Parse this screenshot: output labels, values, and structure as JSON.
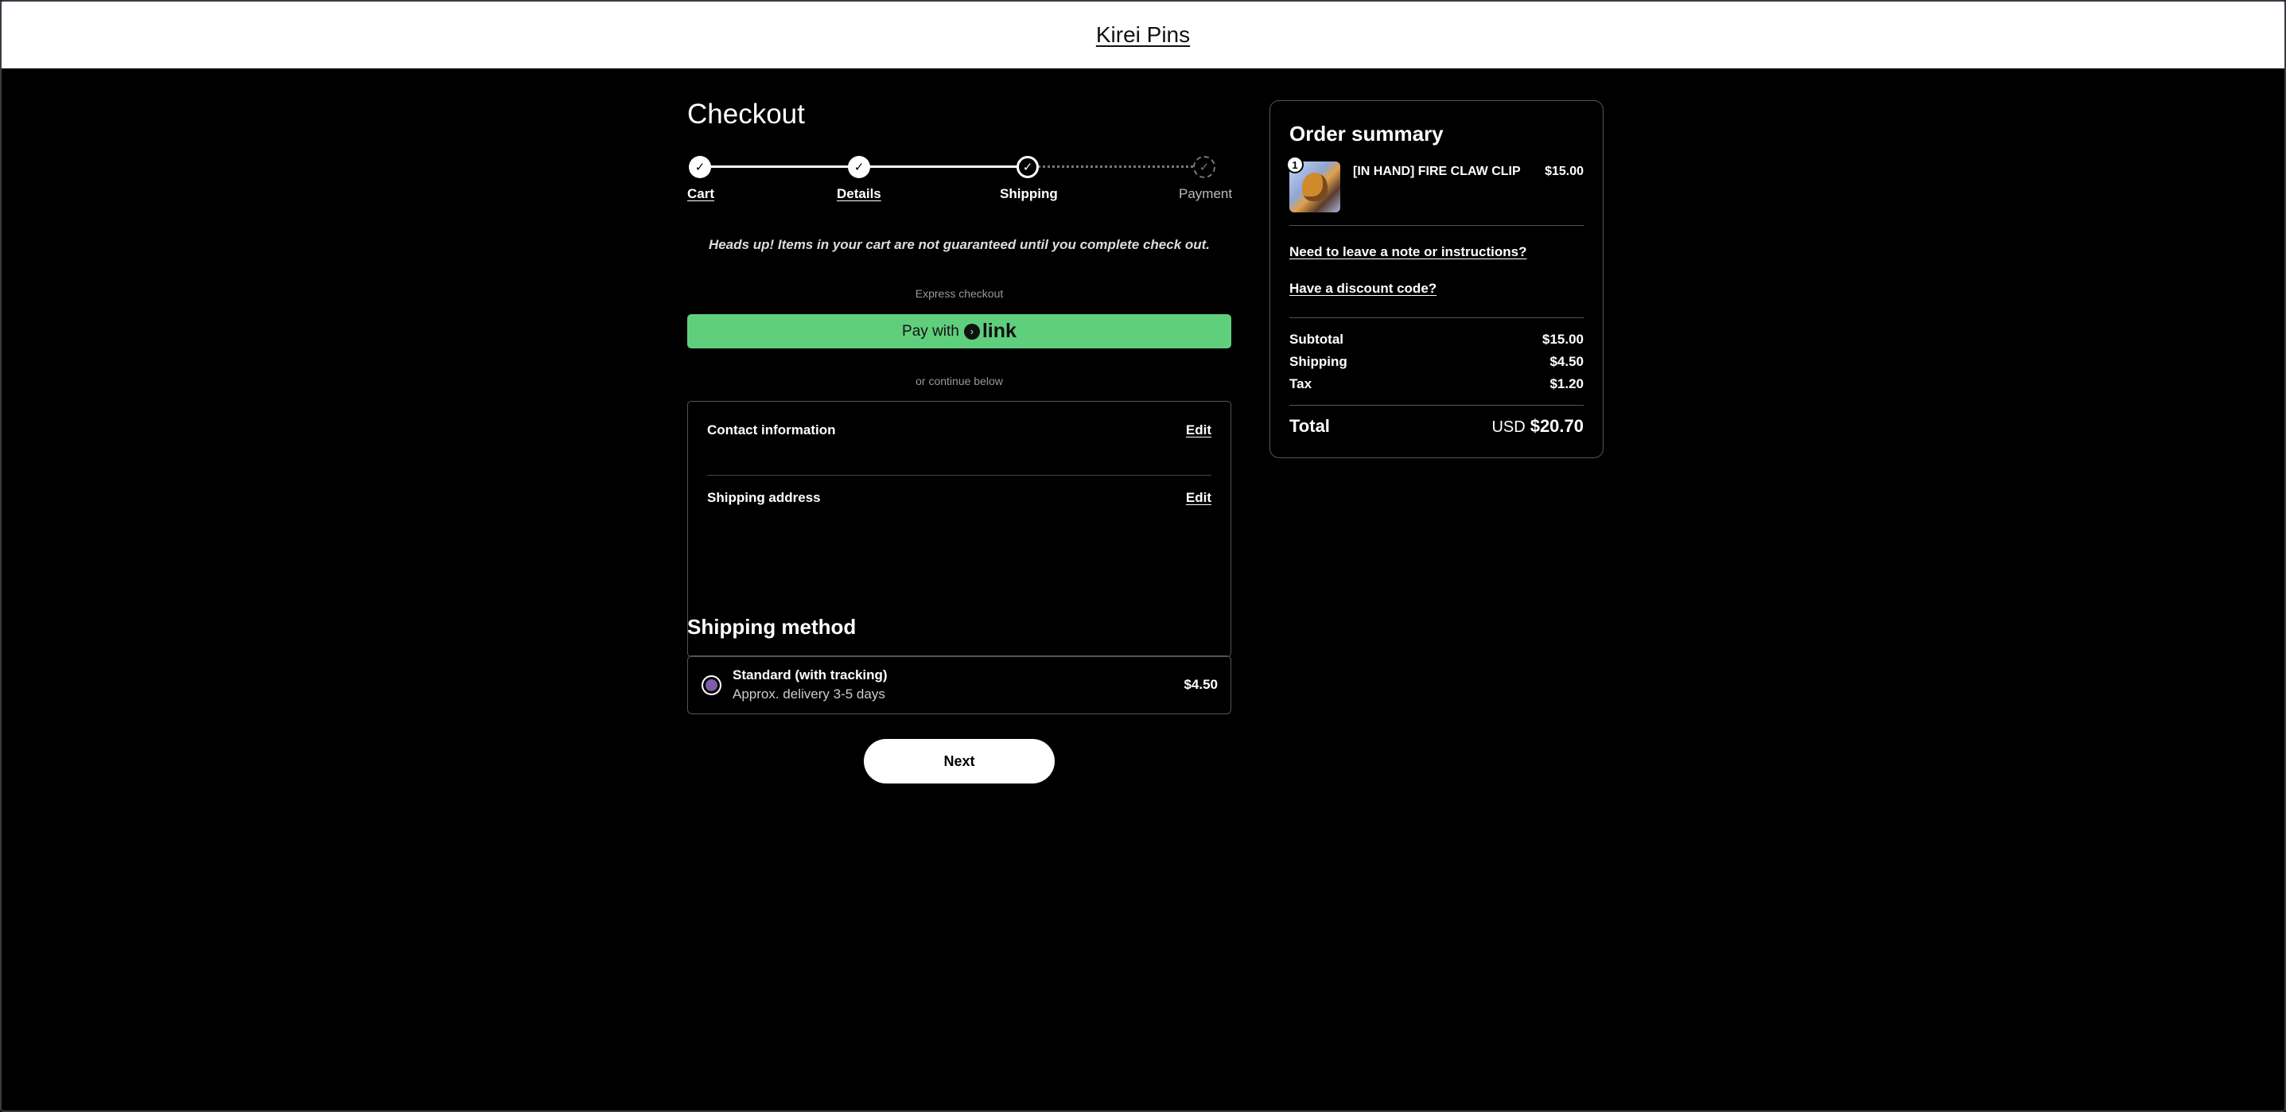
{
  "header": {
    "store_name": "Kirei Pins"
  },
  "checkout": {
    "title": "Checkout",
    "steps": [
      {
        "label": "Cart",
        "state": "done"
      },
      {
        "label": "Details",
        "state": "done"
      },
      {
        "label": "Shipping",
        "state": "current"
      },
      {
        "label": "Payment",
        "state": "todo"
      }
    ],
    "notice": "Heads up! Items in your cart are not guaranteed until you complete check out.",
    "express_label": "Express checkout",
    "link_button": {
      "prefix": "Pay with",
      "brand": "link"
    },
    "continue_label": "or continue below",
    "contact": {
      "label": "Contact information",
      "edit": "Edit"
    },
    "shipping_address": {
      "label": "Shipping address",
      "edit": "Edit"
    },
    "shipping_method": {
      "title": "Shipping method",
      "option": {
        "name": "Standard (with tracking)",
        "eta": "Approx. delivery 3-5 days",
        "price": "$4.50",
        "selected": true
      }
    },
    "next_button": "Next"
  },
  "summary": {
    "title": "Order summary",
    "item": {
      "quantity": "1",
      "name": "[IN HAND] FIRE CLAW CLIP",
      "price": "$15.00"
    },
    "note_link": "Need to leave a note or instructions?",
    "discount_link": "Have a discount code?",
    "subtotal": {
      "label": "Subtotal",
      "value": "$15.00"
    },
    "shipping": {
      "label": "Shipping",
      "value": "$4.50"
    },
    "tax": {
      "label": "Tax",
      "value": "$1.20"
    },
    "total": {
      "label": "Total",
      "currency": "USD",
      "value": "$20.70"
    }
  },
  "colors": {
    "link_green": "#5fcf7d",
    "radio_fill": "#7e5ea8",
    "background": "#000000"
  }
}
